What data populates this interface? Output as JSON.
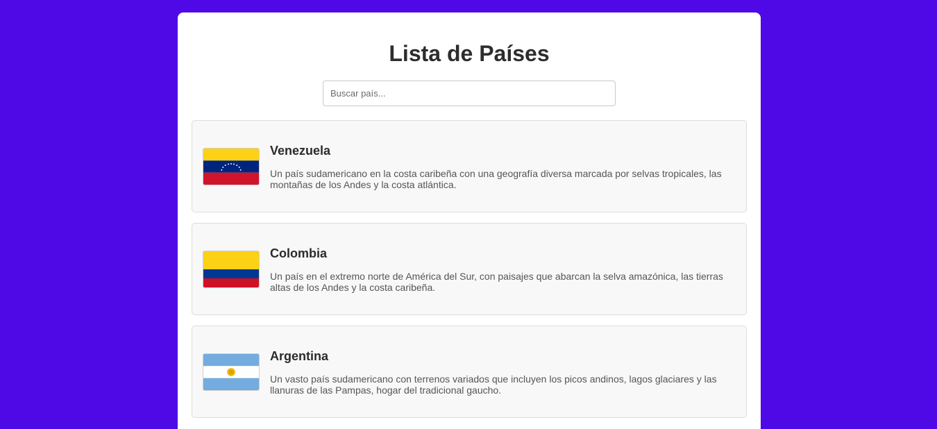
{
  "page": {
    "title": "Lista de Países",
    "background_color": "#4f09e6"
  },
  "search": {
    "placeholder": "Buscar país..."
  },
  "countries": [
    {
      "name": "Venezuela",
      "flag_icon": "venezuela-flag-icon",
      "description": "Un país sudamericano en la costa caribeña con una geografía diversa marcada por selvas tropicales, las montañas de los Andes y la costa atlántica."
    },
    {
      "name": "Colombia",
      "flag_icon": "colombia-flag-icon",
      "description": "Un país en el extremo norte de América del Sur, con paisajes que abarcan la selva amazónica, las tierras altas de los Andes y la costa caribeña."
    },
    {
      "name": "Argentina",
      "flag_icon": "argentina-flag-icon",
      "description": "Un vasto país sudamericano con terrenos variados que incluyen los picos andinos, lagos glaciares y las llanuras de las Pampas, hogar del tradicional gaucho."
    }
  ]
}
